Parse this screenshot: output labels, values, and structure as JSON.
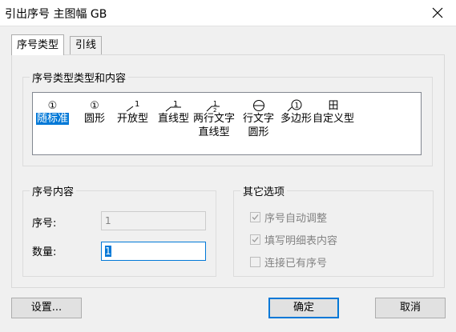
{
  "window": {
    "title": "引出序号 主图幅 GB"
  },
  "tabs": [
    {
      "label": "序号类型"
    },
    {
      "label": "引线"
    }
  ],
  "type_group": {
    "label": "序号类型类型和内容",
    "items": [
      {
        "label": "随标准",
        "label2": "",
        "icon": "circle-number-icon",
        "glyph": "①"
      },
      {
        "label": "圆形",
        "label2": "",
        "icon": "circle-number-icon",
        "glyph": "①"
      },
      {
        "label": "开放型",
        "label2": "",
        "icon": "open-leader-icon",
        "glyph": "1"
      },
      {
        "label": "直线型",
        "label2": "",
        "icon": "underline-leader-icon",
        "glyph": "1"
      },
      {
        "label": "两行文字",
        "label2": "直线型",
        "icon": "two-line-leader-icon",
        "glyph": "½"
      },
      {
        "label": "行文字",
        "label2": "圆形",
        "icon": "two-line-circle-icon",
        "glyph": "⊖"
      },
      {
        "label": "多边形",
        "label2": "",
        "icon": "polygon-number-icon",
        "glyph": "①"
      },
      {
        "label": "自定义型",
        "label2": "",
        "icon": "custom-table-icon",
        "glyph": "田"
      }
    ]
  },
  "content_group": {
    "label": "序号内容",
    "serial_label": "序号:",
    "serial_value": "1",
    "qty_label": "数量:",
    "qty_value": "1"
  },
  "options_group": {
    "label": "其它选项",
    "options": [
      {
        "label": "序号自动调整",
        "checked": true
      },
      {
        "label": "填写明细表内容",
        "checked": true
      },
      {
        "label": "连接已有序号",
        "checked": false
      }
    ]
  },
  "buttons": {
    "settings": "设置...",
    "ok": "确定",
    "cancel": "取消"
  },
  "colors": {
    "accent": "#0078d7",
    "disabled_text": "#838383"
  }
}
